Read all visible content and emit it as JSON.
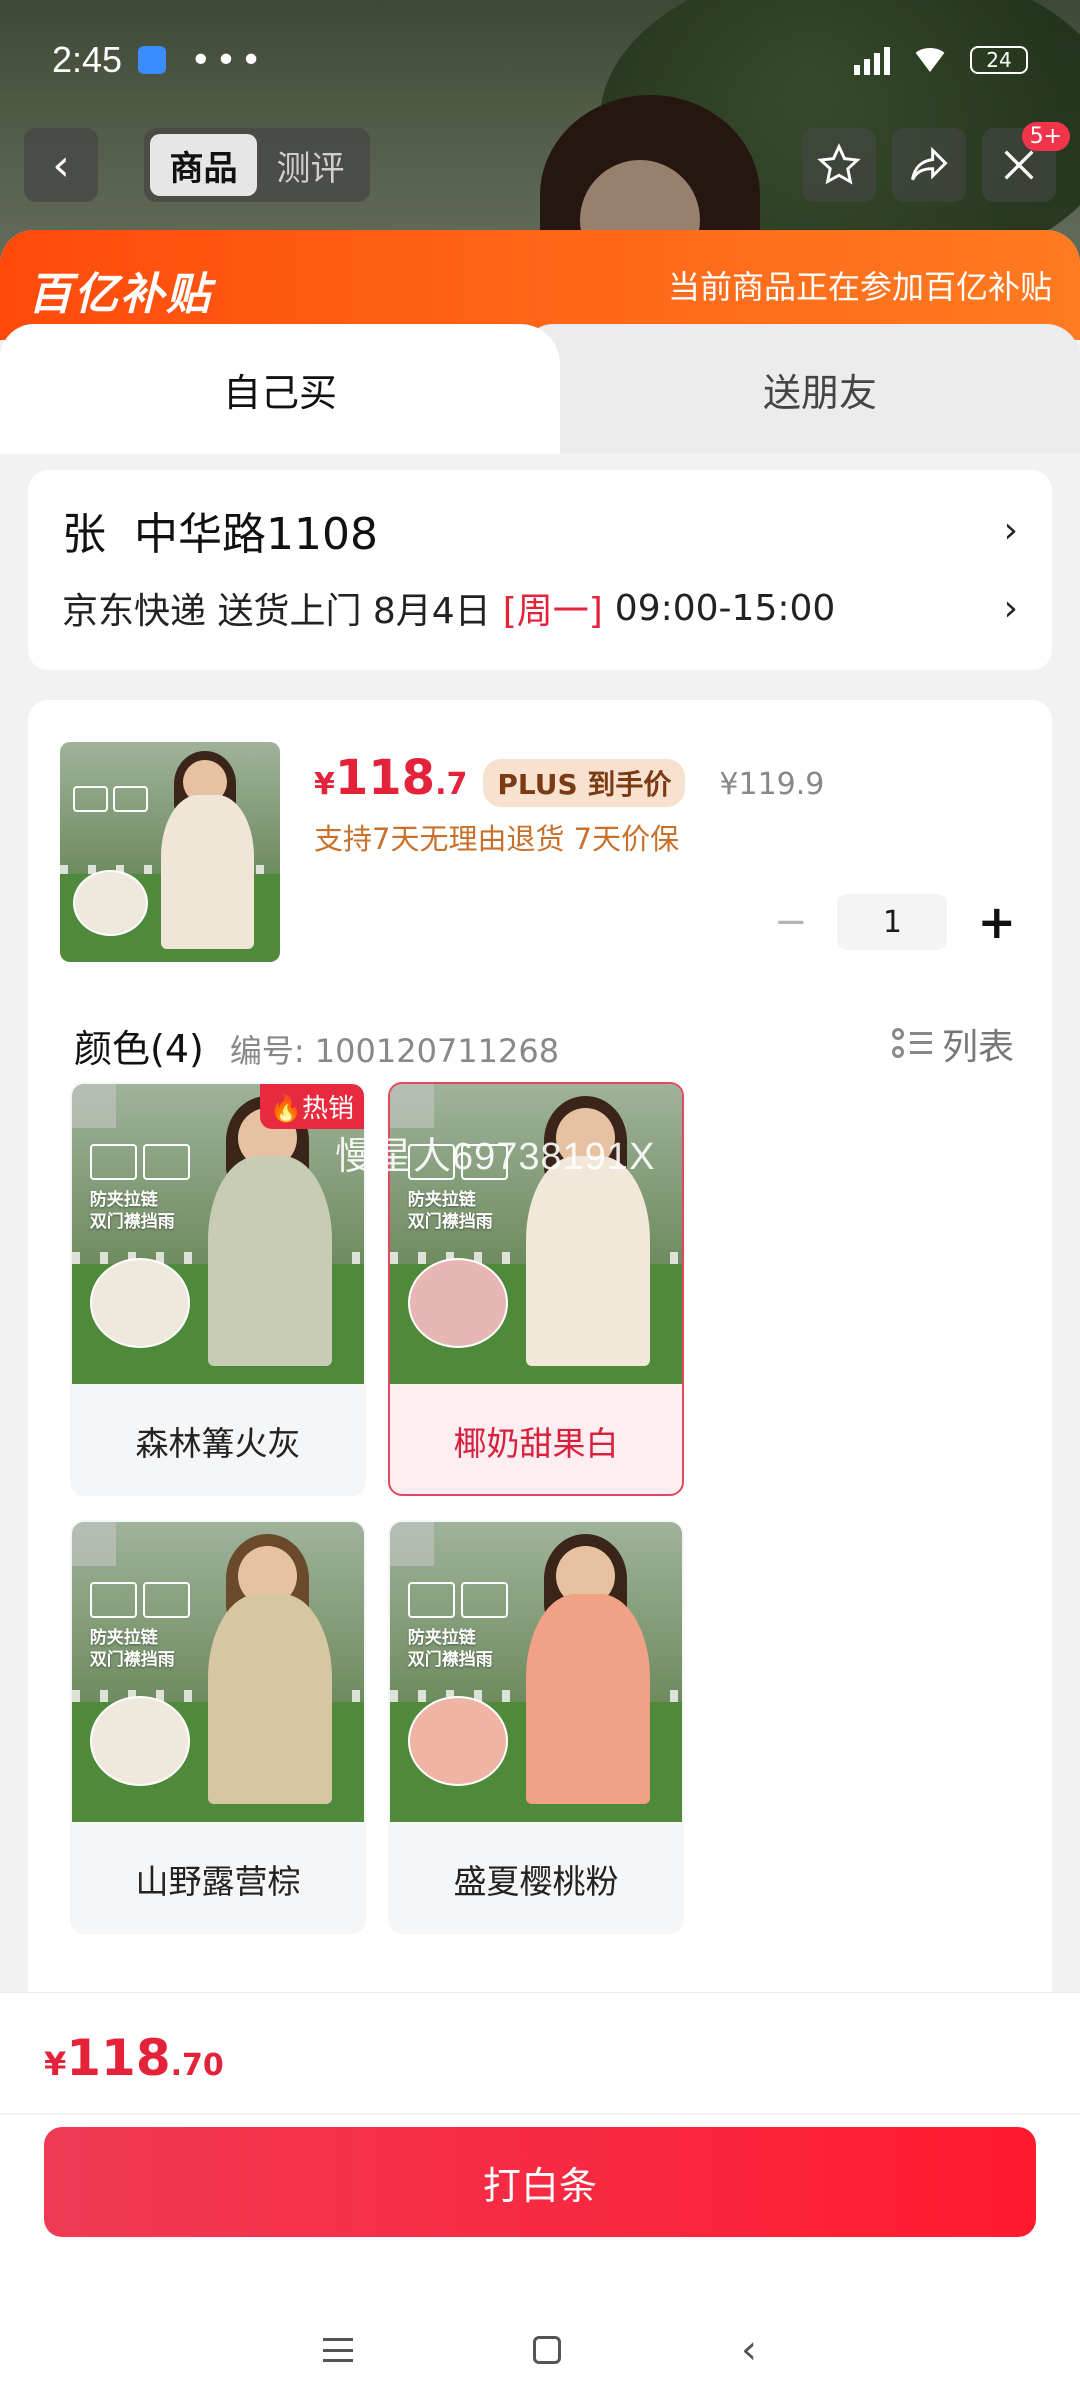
{
  "status_bar": {
    "time": "2:45",
    "dots": "•••",
    "battery": "24"
  },
  "nav": {
    "back_icon": "‹",
    "segments": [
      "商品",
      "测评"
    ],
    "badge": "5+"
  },
  "subsidy": {
    "logo": "百亿补贴",
    "text": "当前商品正在参加百亿补贴"
  },
  "tabs": {
    "self_buy": "自己买",
    "gift": "送朋友"
  },
  "address": {
    "name": "张",
    "street": "中华路1108",
    "delivery_prefix": "京东快递 送货上门 8月4日",
    "weekday": "[周一]",
    "time_window": "09:00-15:00"
  },
  "product": {
    "yen": "¥",
    "price_main": "118",
    "price_dec": ".7",
    "plus_tag": "PLUS 到手价",
    "orig_price": "¥119.9",
    "services": "支持7天无理由退货  7天价保",
    "qty_minus": "−",
    "qty": "1",
    "qty_plus": "+"
  },
  "colors": {
    "title": "颜色(4)",
    "sku": "编号: 100120711268",
    "list_label": "列表",
    "hot_tag": "🔥热销",
    "items": [
      {
        "label": "森林篝火灰",
        "selected": false
      },
      {
        "label": "椰奶甜果白",
        "selected": true
      },
      {
        "label": "山野露营棕",
        "selected": false
      },
      {
        "label": "盛夏樱桃粉",
        "selected": false
      }
    ],
    "img_text_1": "防夹拉链",
    "img_text_2": "双门襟挡雨"
  },
  "watermark": "慢星人69738191X",
  "bottom": {
    "yen": "¥",
    "total_main": "118",
    "total_dec": ".70",
    "pay_label": "打白条"
  },
  "colors_palette": {
    "accent": "#e4233b",
    "subsidy": "#ff4a0c",
    "plus_bg": "#f8e2cf"
  }
}
